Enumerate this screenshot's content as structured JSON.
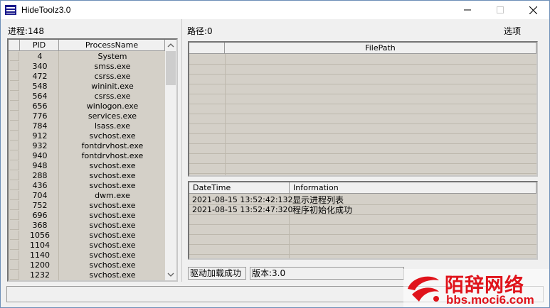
{
  "window": {
    "title": "HideToolz3.0"
  },
  "process_panel": {
    "count_label": "进程:148",
    "columns": [
      "PID",
      "ProcessName"
    ],
    "rows": [
      {
        "pid": "4",
        "name": "System"
      },
      {
        "pid": "340",
        "name": "smss.exe"
      },
      {
        "pid": "472",
        "name": "csrss.exe"
      },
      {
        "pid": "548",
        "name": "wininit.exe"
      },
      {
        "pid": "564",
        "name": "csrss.exe"
      },
      {
        "pid": "656",
        "name": "winlogon.exe"
      },
      {
        "pid": "776",
        "name": "services.exe"
      },
      {
        "pid": "784",
        "name": "lsass.exe"
      },
      {
        "pid": "912",
        "name": "svchost.exe"
      },
      {
        "pid": "932",
        "name": "fontdrvhost.exe"
      },
      {
        "pid": "940",
        "name": "fontdrvhost.exe"
      },
      {
        "pid": "948",
        "name": "svchost.exe"
      },
      {
        "pid": "288",
        "name": "svchost.exe"
      },
      {
        "pid": "436",
        "name": "svchost.exe"
      },
      {
        "pid": "704",
        "name": "dwm.exe"
      },
      {
        "pid": "752",
        "name": "svchost.exe"
      },
      {
        "pid": "696",
        "name": "svchost.exe"
      },
      {
        "pid": "368",
        "name": "svchost.exe"
      },
      {
        "pid": "1056",
        "name": "svchost.exe"
      },
      {
        "pid": "1104",
        "name": "svchost.exe"
      },
      {
        "pid": "1140",
        "name": "svchost.exe"
      },
      {
        "pid": "1200",
        "name": "svchost.exe"
      },
      {
        "pid": "1232",
        "name": "svchost.exe"
      }
    ]
  },
  "path_panel": {
    "path_label": "路径:0",
    "options_label": "选项",
    "columns": [
      "FilePath"
    ]
  },
  "log_panel": {
    "columns": [
      "DateTime",
      "Information"
    ],
    "rows": [
      {
        "time": "2021-08-15 13:52:42:132",
        "info": "显示进程列表"
      },
      {
        "time": "2021-08-15 13:52:47:320",
        "info": "程序初始化成功"
      }
    ]
  },
  "status": {
    "driver": "驱动加载成功",
    "version": "版本:3.0"
  },
  "watermark": {
    "cn": "陌辞网络",
    "url": "bbs.moci6.com",
    "brand_color": "#e0131b"
  },
  "icons": [
    "app-icon",
    "minimize-icon",
    "maximize-icon",
    "close-icon",
    "scroll-up-icon",
    "scroll-down-icon"
  ]
}
